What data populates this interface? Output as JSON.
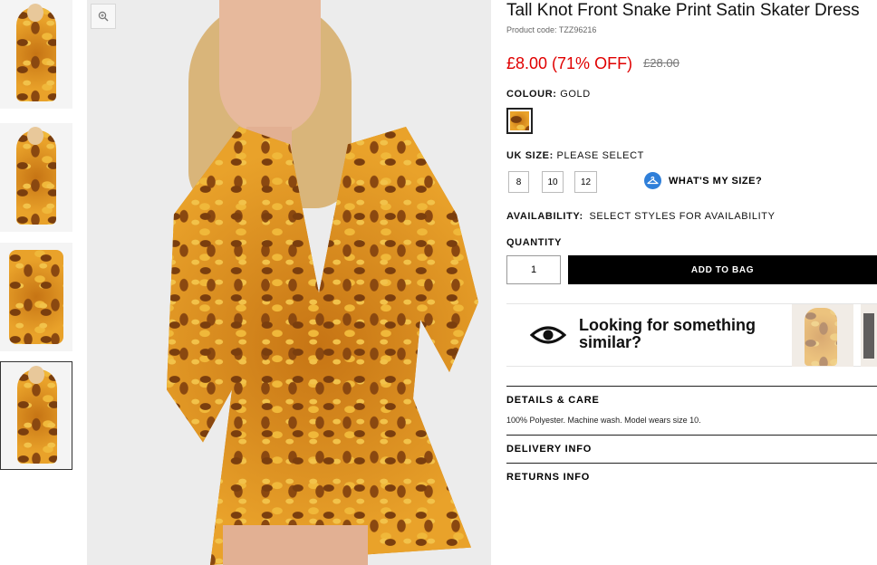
{
  "product": {
    "title": "Tall Knot Front Snake Print Satin Skater Dress",
    "code": "Product code: TZZ96216",
    "price": "£8.00 (71% OFF)",
    "old_price": "£28.00"
  },
  "colour": {
    "label": "COLOUR:",
    "value": "GOLD"
  },
  "size": {
    "label": "UK SIZE:",
    "value": "PLEASE SELECT",
    "options": [
      "8",
      "10",
      "12"
    ],
    "whats_my_size": "WHAT'S MY SIZE?"
  },
  "availability": {
    "label": "AVAILABILITY:",
    "value": "SELECT STYLES FOR AVAILABILITY"
  },
  "quantity": {
    "label": "QUANTITY",
    "value": "1"
  },
  "add_to_bag": "ADD TO BAG",
  "similar": {
    "text": "Looking for something similar?"
  },
  "accordion": {
    "details": {
      "title": "DETAILS & CARE",
      "body": "100% Polyester. Machine wash. Model wears size 10."
    },
    "delivery": {
      "title": "DELIVERY INFO"
    },
    "returns": {
      "title": "RETURNS INFO"
    }
  },
  "icons": [
    "zoom-icon",
    "hanger-icon",
    "eye-icon"
  ],
  "colors": {
    "sale": "#e00000",
    "button": "#000000",
    "accent": "#2f7fd9"
  }
}
